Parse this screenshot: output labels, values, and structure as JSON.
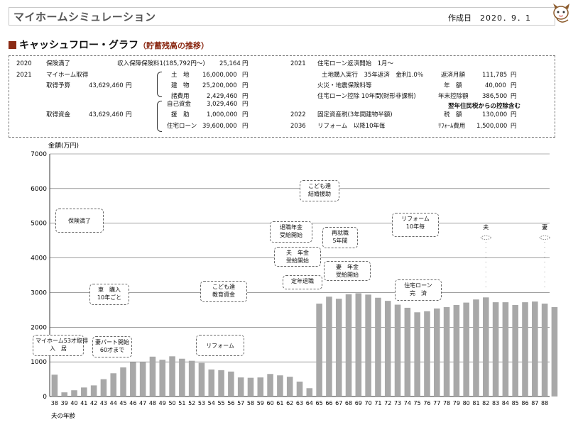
{
  "header": {
    "app_title": "マイホームシミュレーション",
    "date_label": "作成日",
    "date_value": "2020．9．1"
  },
  "section": {
    "title": "キャッシュフロー・グラフ",
    "subtitle": "（貯蓄残高の推移）"
  },
  "info": {
    "left": [
      {
        "year": "2020",
        "label": "保険満了",
        "sub": "収入保障保険料1(185,792円～)",
        "amount": "25,164",
        "unit": "円"
      },
      {
        "year": "2021",
        "label": "マイホーム取得"
      },
      {
        "label": "取得予算",
        "amount": "43,629,460",
        "unit": "円"
      },
      {
        "label": "取得資金",
        "amount": "43,629,460",
        "unit": "円"
      }
    ],
    "breakdown1": [
      {
        "label": "土　地",
        "amount": "16,000,000",
        "unit": "円"
      },
      {
        "label": "建　物",
        "amount": "25,200,000",
        "unit": "円"
      },
      {
        "label": "諸費用",
        "amount": "2,429,460",
        "unit": "円"
      }
    ],
    "breakdown2": [
      {
        "label": "自己資金",
        "amount": "3,029,460",
        "unit": "円"
      },
      {
        "label": "援　助",
        "amount": "1,000,000",
        "unit": "円"
      },
      {
        "label": "住宅ローン",
        "amount": "39,600,000",
        "unit": "円"
      }
    ],
    "right": [
      {
        "year": "2021",
        "label": "住宅ローン返済開始　1月～"
      },
      {
        "label": "土地購入実行　35年返済　金利1.0％",
        "k": "返済月額",
        "amount": "111,785",
        "unit": "円"
      },
      {
        "label": "火災・地震保険料等",
        "k": "年　額",
        "amount": "40,000",
        "unit": "円"
      },
      {
        "label": "住宅ローン控除 10年間(財形非課税)",
        "k": "年末控除額",
        "amount": "386,500",
        "unit": "円"
      },
      {
        "note": "翌年住民税からの控除含む"
      },
      {
        "year": "2022",
        "label": "固定資産税(3年間建物半額)",
        "k": "税　額",
        "amount": "130,000",
        "unit": "円"
      },
      {
        "year": "2036",
        "label": "リフォーム　以降10年毎",
        "k": "ﾘﾌｫｰﾑ費用",
        "amount": "1,500,000",
        "unit": "円"
      }
    ]
  },
  "chart_data": {
    "type": "bar",
    "ylabel": "金額(万円)",
    "xlabel": "夫の年齢",
    "ylim": [
      0,
      7000
    ],
    "yticks": [
      0,
      1000,
      2000,
      3000,
      4000,
      5000,
      6000,
      7000
    ],
    "grid": true,
    "categories": [
      "38",
      "39",
      "40",
      "41",
      "42",
      "43",
      "44",
      "45",
      "46",
      "47",
      "48",
      "49",
      "50",
      "51",
      "52",
      "53",
      "54",
      "55",
      "56",
      "57",
      "58",
      "59",
      "60",
      "61",
      "62",
      "63",
      "64",
      "65",
      "66",
      "67",
      "68",
      "69",
      "70",
      "71",
      "72",
      "73",
      "74",
      "75",
      "76",
      "77",
      "78",
      "79",
      "80",
      "81",
      "82",
      "83",
      "84",
      "85",
      "86",
      "87",
      "88"
    ],
    "values": [
      630,
      120,
      180,
      260,
      320,
      500,
      670,
      840,
      990,
      1000,
      1150,
      1060,
      1160,
      1090,
      1030,
      970,
      780,
      760,
      720,
      550,
      540,
      550,
      650,
      610,
      570,
      430,
      240,
      2680,
      2880,
      2820,
      2950,
      2980,
      2940,
      2850,
      2760,
      2650,
      2560,
      2430,
      2460,
      2540,
      2580,
      2640,
      2710,
      2800,
      2860,
      2720,
      2720,
      2640,
      2720,
      2740,
      2680,
      2580
    ]
  },
  "bubbles": [
    {
      "id": "insurance",
      "text": [
        "保険満了"
      ]
    },
    {
      "id": "car",
      "text": [
        "車　購入",
        "10年ごと"
      ]
    },
    {
      "id": "edu",
      "text": [
        "こども達",
        "教育資金"
      ]
    },
    {
      "id": "wedding",
      "text": [
        "こども達",
        "結婚援助"
      ]
    },
    {
      "id": "pension-start",
      "text": [
        "退職年金",
        "受給開始"
      ]
    },
    {
      "id": "reemploy",
      "text": [
        "再就職",
        "5年間"
      ]
    },
    {
      "id": "reform10",
      "text": [
        "リフォーム",
        "10年毎"
      ]
    },
    {
      "id": "husband-pension",
      "text": [
        "夫　年金",
        "受給開始"
      ]
    },
    {
      "id": "retire",
      "text": [
        "定年退職"
      ]
    },
    {
      "id": "wife-pension",
      "text": [
        "妻　年金",
        "受給開始"
      ]
    },
    {
      "id": "loan-done",
      "text": [
        "住宅ローン",
        "完　済"
      ]
    },
    {
      "id": "myhome",
      "text": [
        "マイホーム53才取得",
        "入　居"
      ]
    },
    {
      "id": "wife-part",
      "text": [
        "妻パート開始",
        "60才まで"
      ]
    },
    {
      "id": "reform",
      "text": [
        "リフォーム"
      ]
    }
  ],
  "markers": {
    "husband": "夫",
    "wife": "妻"
  }
}
